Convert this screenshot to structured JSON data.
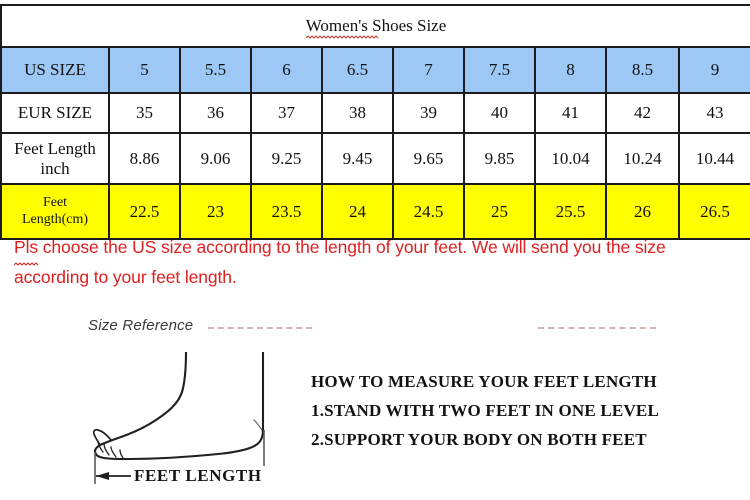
{
  "table": {
    "title": "Women's Shoes Size",
    "row_labels": [
      "US SIZE",
      "EUR SIZE",
      "Feet Length inch",
      "Feet Length(cm)"
    ],
    "row_label_lines": {
      "us": [
        "US SIZE"
      ],
      "eur": [
        "EUR SIZE"
      ],
      "inch": [
        "Feet Length",
        "inch"
      ],
      "cm": [
        "Feet",
        "Length(cm)"
      ]
    },
    "us_size": [
      "5",
      "5.5",
      "6",
      "6.5",
      "7",
      "7.5",
      "8",
      "8.5",
      "9"
    ],
    "eur_size": [
      "35",
      "36",
      "37",
      "38",
      "39",
      "40",
      "41",
      "42",
      "43"
    ],
    "feet_inch": [
      "8.86",
      "9.06",
      "9.25",
      "9.45",
      "9.65",
      "9.85",
      "10.04",
      "10.24",
      "10.44"
    ],
    "feet_cm": [
      "22.5",
      "23",
      "23.5",
      "24",
      "24.5",
      "25",
      "25.5",
      "26",
      "26.5"
    ],
    "colors": {
      "header_row": "#9dc8f5",
      "cm_row": "#ffff00",
      "border": "#1b1b1b",
      "text": "#111111"
    }
  },
  "note": {
    "line1_prefix": "Pls",
    "line1_rest": " choose the US size according to the length of your feet. We will send you the size",
    "line2": "according to your feet length.",
    "color": "#e02020"
  },
  "size_reference": {
    "label": "Size Reference"
  },
  "diagram": {
    "measure_label": "FEET LENGTH"
  },
  "instructions": {
    "heading": "HOW TO MEASURE YOUR FEET LENGTH",
    "steps": [
      "1.STAND WITH TWO FEET IN ONE LEVEL",
      "2.SUPPORT YOUR BODY ON BOTH FEET"
    ]
  }
}
